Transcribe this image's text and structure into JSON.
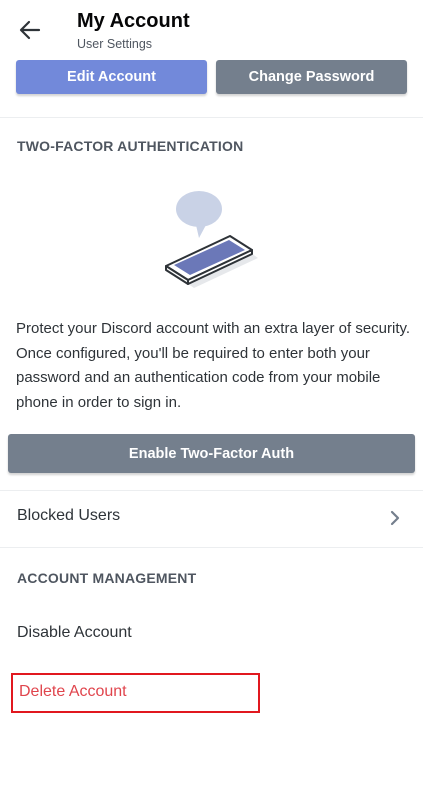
{
  "header": {
    "title": "My Account",
    "subtitle": "User Settings",
    "back_icon": "arrow-left-icon"
  },
  "account_buttons": {
    "edit_label": "Edit Account",
    "change_password_label": "Change Password"
  },
  "two_factor": {
    "section_title": "TWO-FACTOR AUTHENTICATION",
    "illustration_icon": "phone-with-speech-bubble-icon",
    "description": "Protect your Discord account with an extra layer of security. Once configured, you'll be required to enter both your password and an authentication code from your mobile phone in order to sign in.",
    "enable_label": "Enable Two-Factor Auth"
  },
  "blocked_users": {
    "label": "Blocked Users",
    "chevron_icon": "chevron-right-icon"
  },
  "account_management": {
    "section_title": "ACCOUNT MANAGEMENT",
    "disable_label": "Disable Account",
    "delete_label": "Delete Account"
  },
  "colors": {
    "blurple": "#7289da",
    "grey_button": "#747f8d",
    "danger": "#e0454d",
    "highlight_box": "#e1181f"
  }
}
